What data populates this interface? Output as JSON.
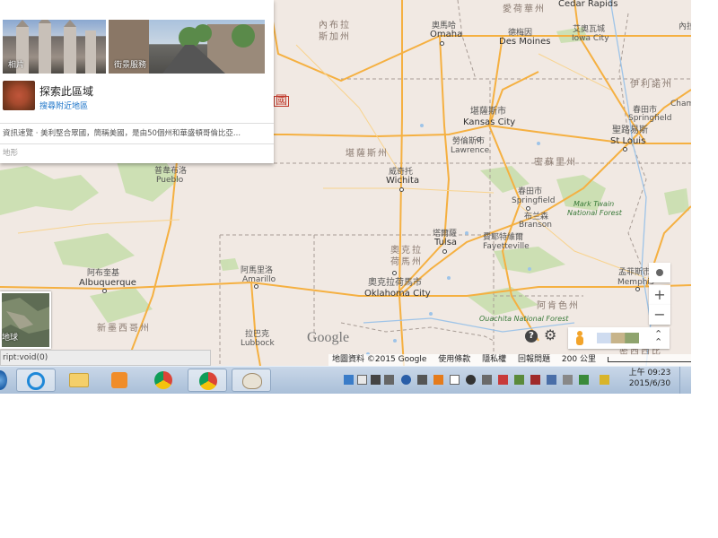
{
  "panel": {
    "photos_label": "相片",
    "streetview_label": "街景服務",
    "explore_title": "探索此區域",
    "explore_link": "搜尋附近地區",
    "info_text": "資訊速覽 · 美利堅合眾國，簡稱美國，是由50個州和華盛頓哥倫比亞...",
    "terrain_label": "地形"
  },
  "earth_label": "地球",
  "status_text": "ript:void(0)",
  "map": {
    "labels": {
      "cedar_rapids": "Cedar Rapids",
      "iowa_state": "愛荷華州",
      "nebraska_zh": "內布拉",
      "nebraska_zh2": "斯加州",
      "omaha_zh": "奧馬哈",
      "omaha": "Omaha",
      "desmoines_zh": "德梅因",
      "desmoines": "Des Moines",
      "iowacity_zh": "艾奧瓦城",
      "iowacity": "Iowa City",
      "neila": "內拉",
      "illinois_zh": "伊利諾州",
      "kansascity_zh": "堪薩斯市",
      "kansascity": "Kansas City",
      "lawrence_zh": "勞倫斯市",
      "lawrence": "Lawrence",
      "springfield_il_zh": "春田市",
      "springfield_il": "Springfield",
      "stlouis_zh": "聖路易斯",
      "stlouis": "St Louis",
      "champ": "Cham",
      "kansas_state": "堪薩斯州",
      "missouri_state": "密蘇里州",
      "pueblo_zh": "普韋布洛",
      "pueblo": "Pueblo",
      "wichita_zh": "威奇托",
      "wichita": "Wichita",
      "springfield_mo_zh": "春田市",
      "springfield_mo": "Springfield",
      "branson_zh": "布兰森",
      "branson": "Branson",
      "marktwain1": "Mark Twain",
      "marktwain2": "National Forest",
      "tulsa_zh": "塔爾薩",
      "tulsa": "Tulsa",
      "fayetteville_zh": "費耶特維爾",
      "fayetteville": "Fayetteville",
      "oklahoma_state1": "奧克拉",
      "oklahoma_state2": "荷馬州",
      "albuquerque_zh": "阿布奎基",
      "albuquerque": "Albuquerque",
      "amarillo_zh": "阿馬里洛",
      "amarillo": "Amarillo",
      "okc_zh": "奧克拉荷馬市",
      "okc": "Oklahoma City",
      "memphis_zh": "孟菲斯市",
      "memphis": "Memphis",
      "newmexico_state": "新墨西哥州",
      "lubbock_zh": "拉巴克",
      "lubbock": "Lubbock",
      "ouachita": "Ouachita National Forest",
      "arkansas_state": "阿肯色州",
      "mississippi_partial": "密西西比",
      "country_partial": "國",
      "google_logo": "Google"
    },
    "zoom_in": "+",
    "zoom_out": "−"
  },
  "attribution": {
    "data": "地圖資料 ©2015 Google",
    "terms": "使用條款",
    "privacy": "隱私權",
    "report": "回報問題",
    "scale": "200 公里"
  },
  "clock": {
    "time": "上午 09:23",
    "date": "2015/6/30"
  },
  "colors": {
    "land": "#f1e9e3",
    "highway": "#f5b041",
    "forest": "#c9dfae",
    "water": "#9ec4e8",
    "border": "#a89c95",
    "accent_link": "#1a73c8"
  }
}
